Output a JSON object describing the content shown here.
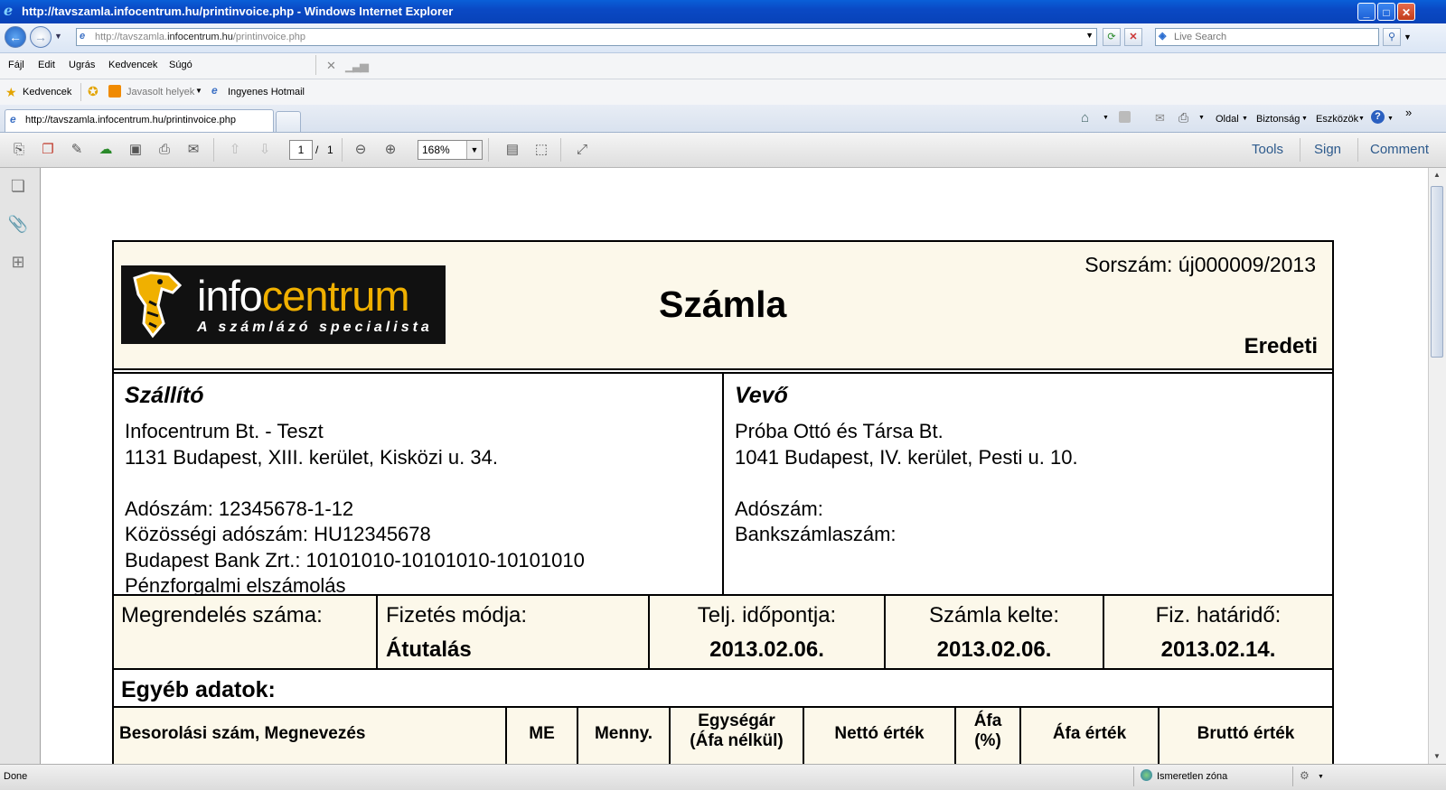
{
  "window": {
    "title": "http://tavszamla.infocentrum.hu/printinvoice.php - Windows Internet Explorer",
    "controls": {
      "minimize": "_",
      "maximize": "□",
      "close": "✕"
    }
  },
  "address_bar": {
    "url_prefix": "http://tavszamla.",
    "url_domain": "infocentrum.hu",
    "url_path": "/printinvoice.php",
    "search_placeholder": "Live Search"
  },
  "menu": {
    "items": [
      "Fájl",
      "Edit",
      "Ugrás",
      "Kedvencek",
      "Súgó"
    ]
  },
  "favorites_bar": {
    "favorites_label": "Kedvencek",
    "suggested_sites": "Javasolt helyek",
    "hotmail": "Ingyenes Hotmail"
  },
  "tabs": {
    "active_tab": "http://tavszamla.infocentrum.hu/printinvoice.php"
  },
  "command_bar": {
    "page": "Oldal",
    "safety": "Biztonság",
    "tools": "Eszközök",
    "more": "»"
  },
  "pdf_toolbar": {
    "current_page": "1",
    "page_sep": "/",
    "total_pages": "1",
    "zoom": "168%",
    "tools": "Tools",
    "sign": "Sign",
    "comment": "Comment"
  },
  "invoice": {
    "logo_text_a": "info",
    "logo_text_b": "centrum",
    "logo_tagline": "A számlázó specialista",
    "serial": "Sorszám: új000009/2013",
    "title": "Számla",
    "copy_type": "Eredeti",
    "supplier": {
      "heading": "Szállító",
      "lines": [
        "Infocentrum Bt. - Teszt",
        "1131 Budapest, XIII. kerület, Kisközi u. 34.",
        "",
        "Adószám: 12345678-1-12",
        "Közösségi adószám: HU12345678",
        "Budapest Bank Zrt.:  10101010-10101010-10101010",
        "Pénzforgalmi elszámolás"
      ]
    },
    "buyer": {
      "heading": "Vevő",
      "lines": [
        "Próba Ottó és Társa Bt.",
        "1041 Budapest, IV. kerület, Pesti u. 10.",
        "",
        "Adószám:",
        "Bankszámlaszám:"
      ]
    },
    "payment": {
      "order_label": "Megrendelés száma:",
      "order_value": "",
      "method_label": "Fizetés módja:",
      "method_value": "Átutalás",
      "perf_label": "Telj. időpontja:",
      "perf_value": "2013.02.06.",
      "issue_label": "Számla kelte:",
      "issue_value": "2013.02.06.",
      "due_label": "Fiz. határidő:",
      "due_value": "2013.02.14."
    },
    "other_data": "Egyéb adatok:",
    "columns": [
      "Besorolási szám, Megnevezés",
      "ME",
      "Menny.",
      "Egységár (Áfa nélkül)",
      "Nettó érték",
      "Áfa (%)",
      "Áfa érték",
      "Bruttó érték"
    ]
  },
  "status_bar": {
    "status": "Done",
    "zone": "Ismeretlen zóna"
  }
}
